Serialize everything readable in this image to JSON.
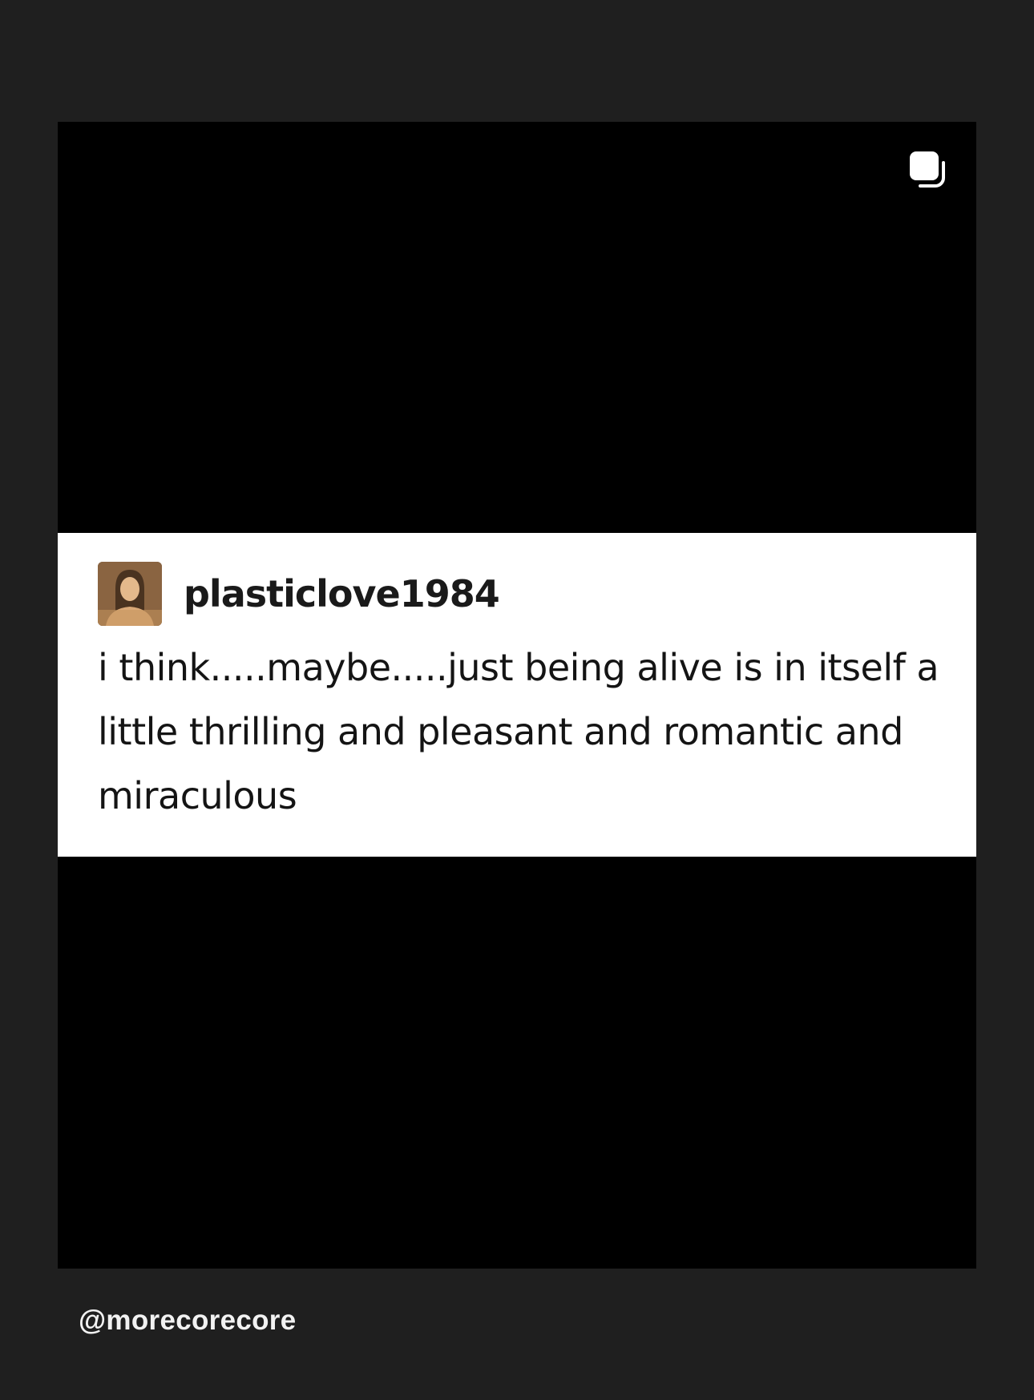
{
  "post": {
    "username": "plasticlove1984",
    "text": "i think.....maybe.....just being alive is in itself a little thrilling and pleasant and romantic and miraculous",
    "avatar_icon": "profile-avatar",
    "multi_post_icon": "carousel-stack-icon"
  },
  "footer": {
    "handle": "@morecorecore"
  },
  "colors": {
    "page_background": "#1f1f1f",
    "post_background": "#000000",
    "card_background": "#ffffff",
    "text": "#141414",
    "handle_text": "#f2f2f2"
  }
}
